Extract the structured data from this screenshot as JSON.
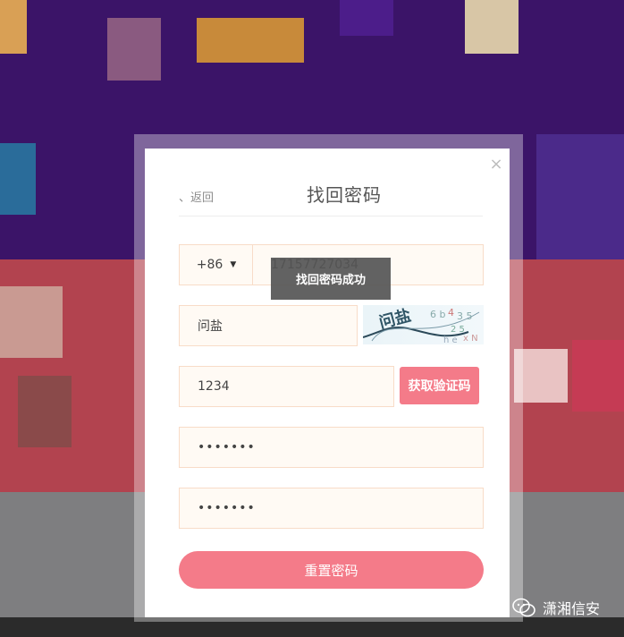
{
  "dialog": {
    "back_label": "、返回",
    "title": "找回密码",
    "close_icon": "×"
  },
  "form": {
    "country_code": "+86",
    "phone": "17157727034",
    "captcha_value": "问盐",
    "captcha_image_text": "问盐",
    "sms_code": "1234",
    "sms_button_label": "获取验证码",
    "password": "•••••••",
    "confirm_password": "•••••••",
    "submit_label": "重置密码"
  },
  "toast": {
    "message": "找回密码成功"
  },
  "watermark": {
    "text": "潇湘信安"
  },
  "colors": {
    "accent": "#f47b89",
    "field_bg": "#fffaf4",
    "field_border": "#f8dcc8"
  }
}
